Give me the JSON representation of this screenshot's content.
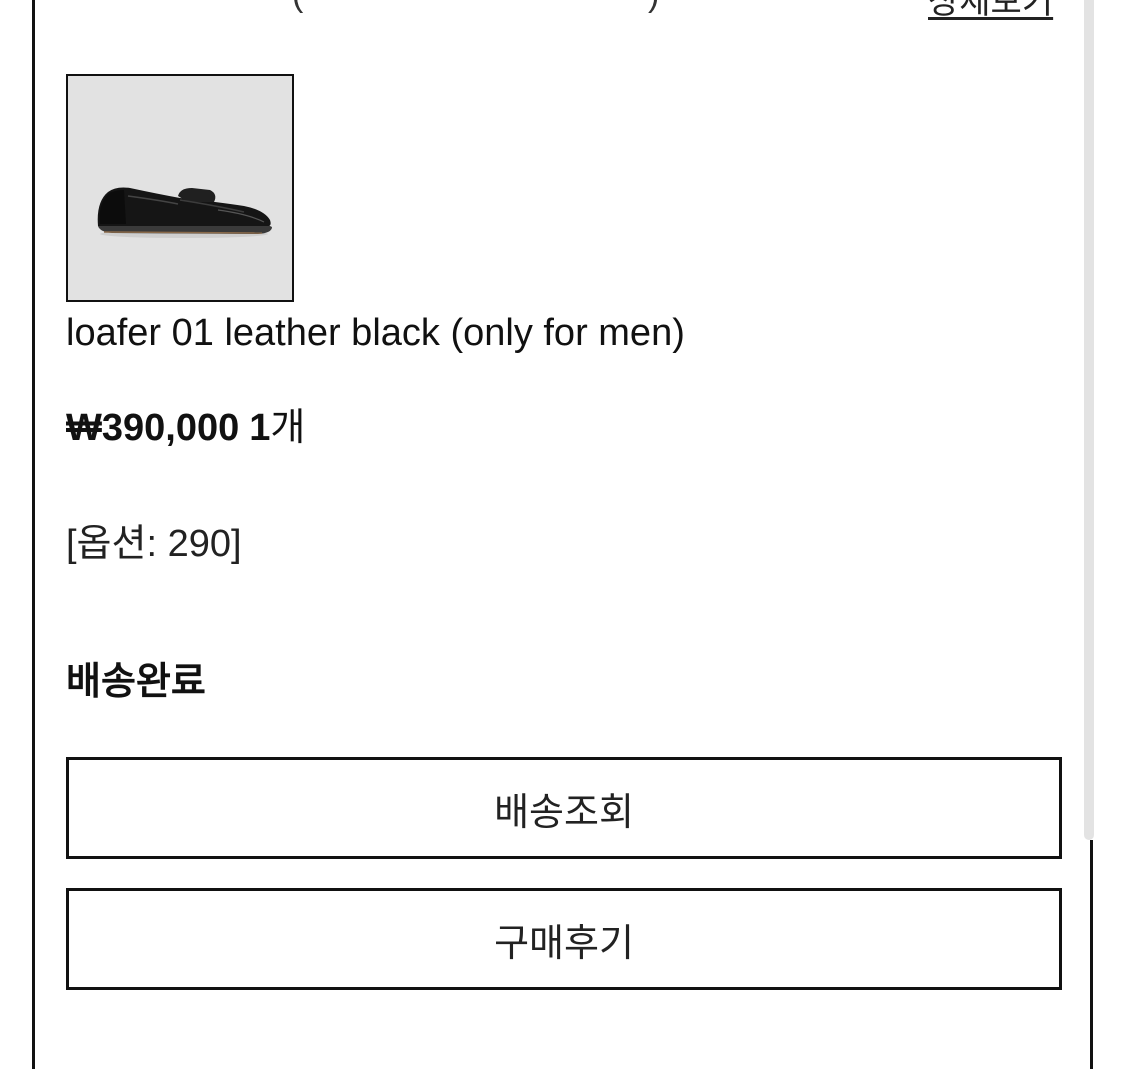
{
  "previous_row": {
    "paren_open": "(",
    "paren_close": ")",
    "detail_link_partial": "상세보기"
  },
  "order_item": {
    "image_alt": "loafer 01 leather black",
    "product_name": "loafer 01 leather black (only for men)",
    "price": "₩390,000",
    "quantity_number": "1",
    "quantity_unit": "개",
    "option": "[옵션: 290]",
    "status": "배송완료"
  },
  "actions": {
    "track_label": "배송조회",
    "review_label": "구매후기"
  }
}
